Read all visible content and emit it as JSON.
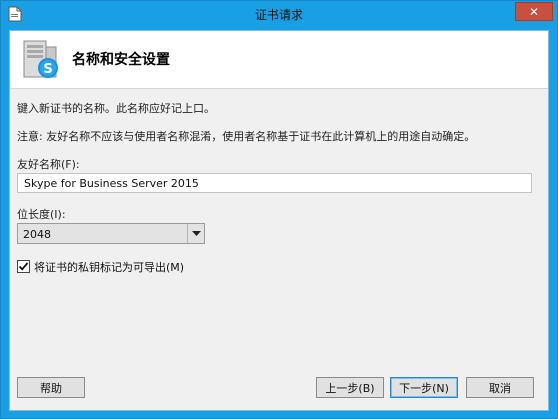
{
  "window": {
    "title": "证书请求",
    "close_glyph": "✕"
  },
  "header": {
    "title": "名称和安全设置",
    "icon": "skype-server-icon"
  },
  "content": {
    "intro": "键入新证书的名称。此名称应好记上口。",
    "note": "注意: 友好名称不应该与使用者名称混淆，使用者名称基于证书在此计算机上的用途自动确定。",
    "friendly_name_label": "友好名称(F):",
    "friendly_name_value": "Skype for Business Server 2015",
    "bit_length_label": "位长度(I):",
    "bit_length_value": "2048",
    "exportable_label": "将证书的私钥标记为可导出(M)",
    "exportable_checked": true
  },
  "buttons": {
    "help": "帮助",
    "back": "上一步(B)",
    "next": "下一步(N)",
    "cancel": "取消"
  },
  "colors": {
    "titlebar": "#19a0e4",
    "close_button": "#c7503f",
    "dialog_bg": "#f0f0f0",
    "header_bg": "#ffffff",
    "default_button_border": "#2b86cf"
  }
}
